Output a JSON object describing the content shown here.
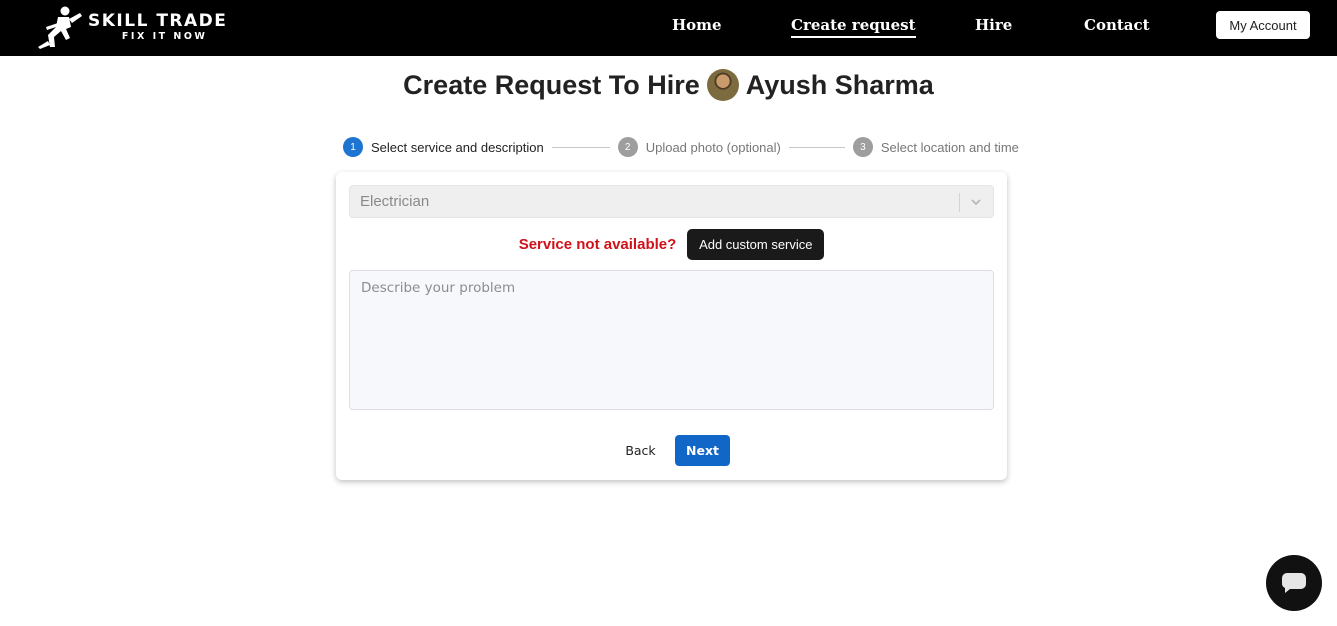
{
  "brand": {
    "name": "SKILL TRADE",
    "tagline": "FIX IT NOW"
  },
  "nav": {
    "items": [
      {
        "label": "Home"
      },
      {
        "label": "Create request",
        "active": true
      },
      {
        "label": "Hire"
      },
      {
        "label": "Contact"
      }
    ],
    "account_label": "My Account"
  },
  "page": {
    "title_prefix": "Create Request To Hire",
    "worker_name": "Ayush Sharma"
  },
  "stepper": {
    "steps": [
      {
        "number": "1",
        "label": "Select service and description",
        "state": "active"
      },
      {
        "number": "2",
        "label": "Upload photo (optional)",
        "state": "inactive"
      },
      {
        "number": "3",
        "label": "Select location and time",
        "state": "inactive"
      }
    ]
  },
  "form": {
    "service_selected": "Electrician",
    "not_available_text": "Service not available?",
    "custom_service_label": "Add custom service",
    "description_placeholder": "Describe your problem",
    "description_value": "",
    "back_label": "Back",
    "next_label": "Next"
  },
  "colors": {
    "accent": "#1e74d1",
    "next_button": "#1167c7",
    "warning_text": "#d0111a",
    "navbar": "#000000"
  },
  "icons": {
    "chat": "chat-bubble-icon",
    "select": "chevron-down-icon",
    "logo": "worker-logo-icon"
  }
}
